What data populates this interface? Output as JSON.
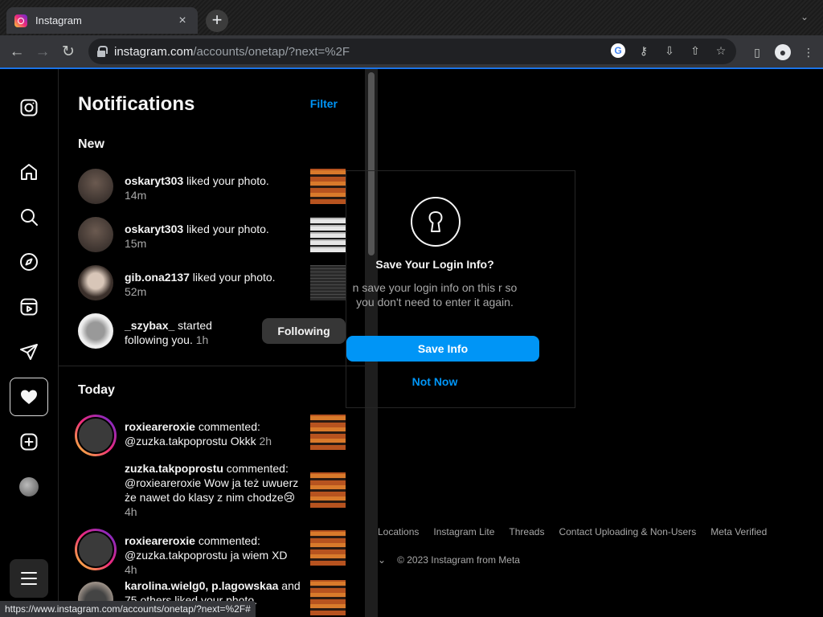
{
  "browser": {
    "tab_title": "Instagram",
    "tab_close": "×",
    "new_tab": "+",
    "url_host": "instagram.com",
    "url_path": "/accounts/onetap/?next=%2F",
    "status_url": "https://www.instagram.com/accounts/onetap/?next=%2F#"
  },
  "notifications": {
    "title": "Notifications",
    "filter_label": "Filter",
    "new_label": "New",
    "today_label": "Today",
    "new_items": [
      {
        "user": "oskaryt303",
        "action": " liked your photo.",
        "time": "14m"
      },
      {
        "user": "oskaryt303",
        "action": " liked your photo.",
        "time": "15m"
      },
      {
        "user": "gib.ona2137",
        "action": " liked your photo.",
        "time": "52m"
      },
      {
        "user": "_szybax_",
        "action": " started following you.",
        "time": "1h",
        "button": "Following"
      }
    ],
    "today_items": [
      {
        "user": "roxieareroxie",
        "action": " commented: @zuzka.takpoprostu Okkk",
        "time": "2h"
      },
      {
        "user": "zuzka.takpoprostu",
        "action": " commented: @roxieareroxie Wow ja też uwuerz że nawet do klasy z nim chodze😢",
        "time": "4h"
      },
      {
        "user": "roxieareroxie",
        "action": " commented: @zuzka.takpoprostu ja wiem XD",
        "time": "4h"
      },
      {
        "user": "karolina.wielg0, p.lagowskaa",
        "action": " and 75 others liked your photo.",
        "time": ""
      }
    ]
  },
  "login_card": {
    "title": "Save Your Login Info?",
    "description": "n save your login info on this r so you don't need to enter it again.",
    "save_label": "Save Info",
    "not_now_label": "Not Now"
  },
  "footer": {
    "links": [
      "Locations",
      "Instagram Lite",
      "Threads",
      "Contact Uploading & Non-Users",
      "Meta Verified"
    ],
    "chevron": "⌄",
    "copyright": "© 2023 Instagram from Meta"
  }
}
